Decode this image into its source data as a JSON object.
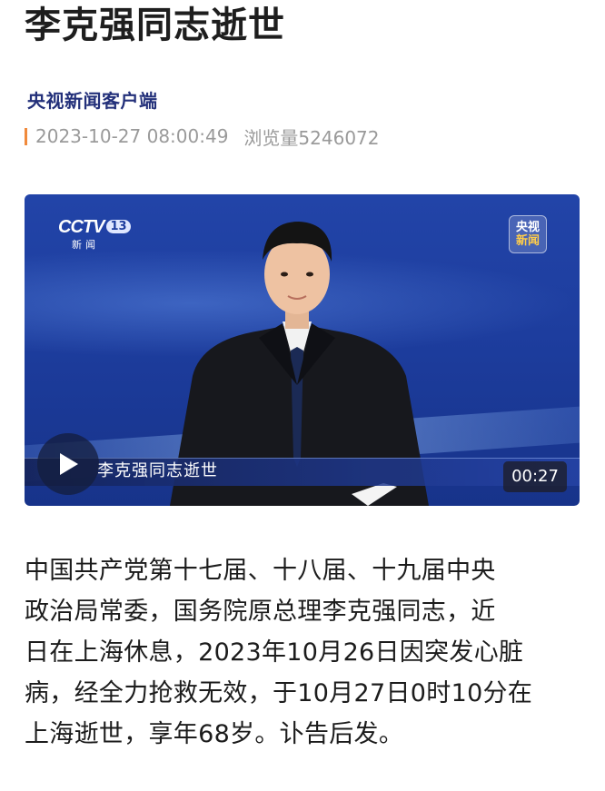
{
  "article": {
    "title": "李克强同志逝世",
    "source": "央视新闻客户端",
    "datetime": "2023-10-27 08:00:49",
    "views_label": "浏览量5246072",
    "body_lines": [
      "中国共产党第十七届、十八届、十九届中央",
      "政治局常委，国务院原总理李克强同志，近",
      "日在上海休息，2023年10月26日因突发心脏",
      "病，经全力抢救无效，于10月27日0时10分在",
      "上海逝世，享年68岁。讣告后发。"
    ]
  },
  "video": {
    "channel_logo": "CCTV",
    "channel_number": "13",
    "channel_sub": "新闻",
    "badge_line1": "央视",
    "badge_line2": "新闻",
    "caption": "李克强同志逝世",
    "duration": "00:27",
    "play_icon": "play-icon"
  },
  "colors": {
    "source": "#23307a",
    "meta_accent": "#f08a3c",
    "meta_text": "#9a9a9a",
    "video_bg": "#1d3d9e"
  }
}
